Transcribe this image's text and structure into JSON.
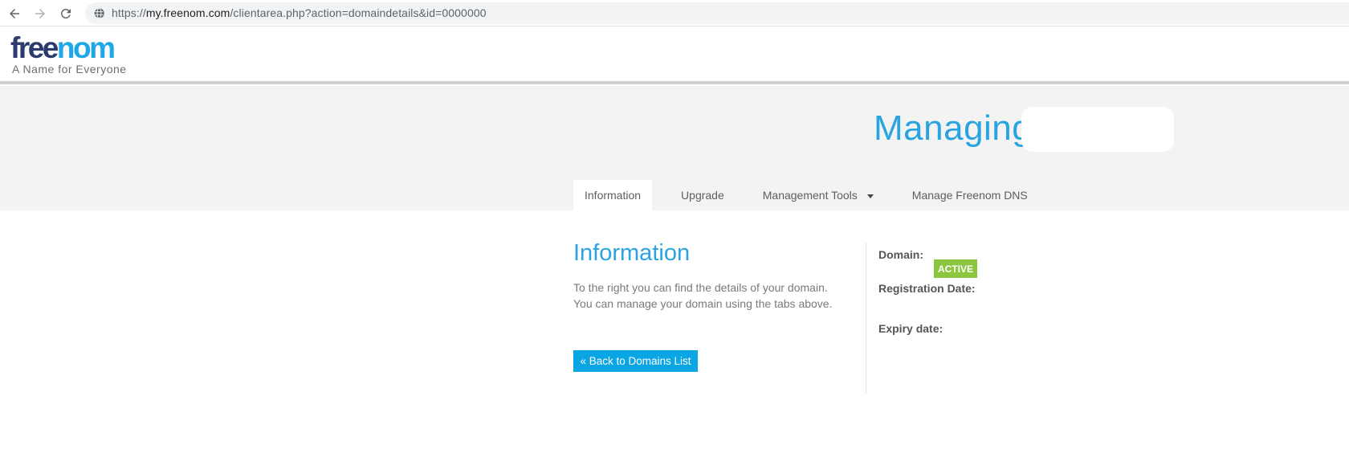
{
  "browser": {
    "url_scheme": "https://",
    "url_host": "my.freenom.com",
    "url_path": "/clientarea.php?action=domaindetails&id=0000000",
    "back_icon": "arrow-left-icon",
    "forward_icon": "arrow-right-icon",
    "reload_icon": "reload-icon",
    "site_icon": "globe-icon"
  },
  "header": {
    "logo_part1": "free",
    "logo_part2": "nom",
    "tagline": "A Name for Everyone"
  },
  "manage": {
    "title": "Managing",
    "tabs": [
      {
        "label": "Information",
        "active": true
      },
      {
        "label": "Upgrade",
        "active": false
      },
      {
        "label": "Management Tools",
        "active": false
      },
      {
        "label": "Manage Freenom DNS",
        "active": false
      }
    ]
  },
  "info": {
    "heading": "Information",
    "line1": "To the right you can find the details of your domain.",
    "line2": "You can manage your domain using the tabs above.",
    "back_button": "« Back to Domains List"
  },
  "details": {
    "domain_label": "Domain:",
    "status": "ACTIVE",
    "registration_label": "Registration Date:",
    "expiry_label": "Expiry date:"
  },
  "colors": {
    "brand_blue": "#2aa4e0",
    "brand_dark": "#2b3b6d",
    "button_blue": "#0aa5e3",
    "status_green": "#8cc63e"
  }
}
